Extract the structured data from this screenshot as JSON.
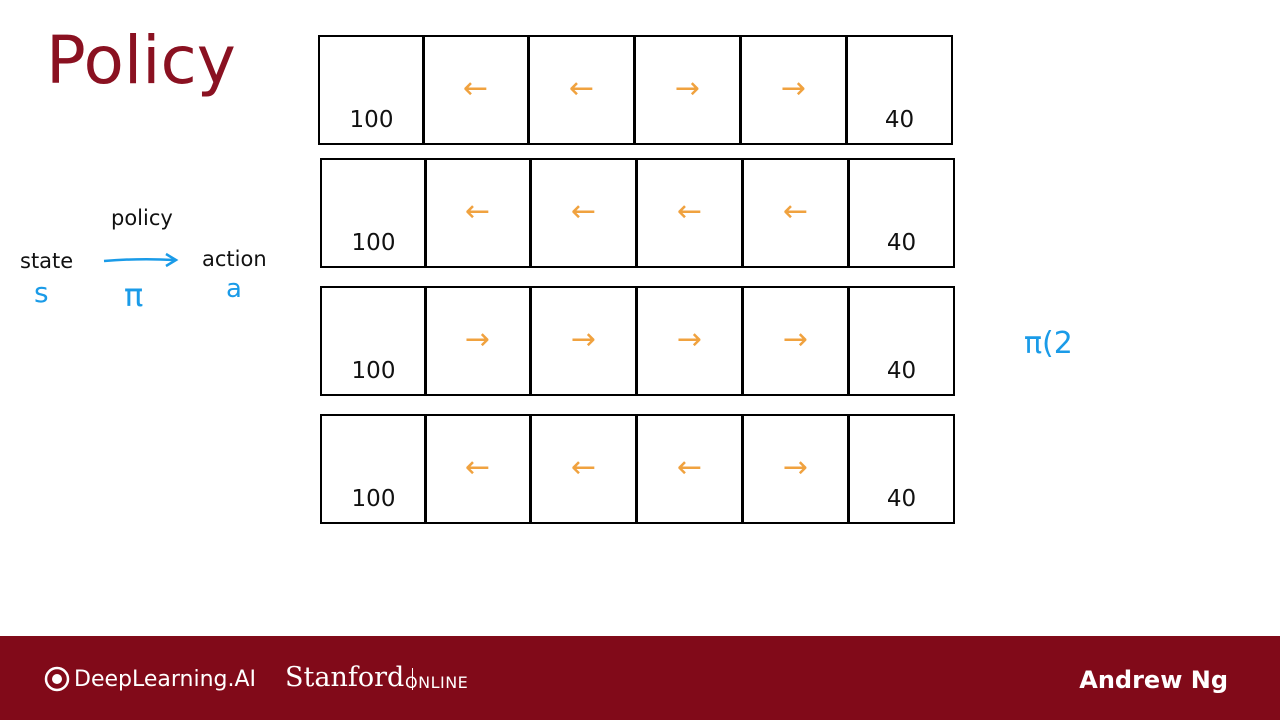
{
  "slide": {
    "title": "Policy",
    "labels": {
      "state": "state",
      "policy": "policy",
      "action": "action",
      "state_symbol": "s",
      "policy_symbol": "π",
      "action_symbol": "a"
    },
    "annotation": "π(2",
    "colors": {
      "title": "#8a1121",
      "arrows": "#f0a23f",
      "handwriting": "#1a9be8",
      "footer": "#810a19"
    }
  },
  "grids": [
    {
      "cells": [
        "100",
        "←",
        "←",
        "→",
        "→",
        "40"
      ]
    },
    {
      "cells": [
        "100",
        "←",
        "←",
        "←",
        "←",
        "40"
      ]
    },
    {
      "cells": [
        "100",
        "→",
        "→",
        "→",
        "→",
        "40"
      ]
    },
    {
      "cells": [
        "100",
        "←",
        "←",
        "←",
        "→",
        "40"
      ]
    }
  ],
  "footer": {
    "brand_deeplearning": "DeepLearning.AI",
    "brand_stanford": "Stanford",
    "brand_online": "ONLINE",
    "presenter": "Andrew Ng"
  }
}
